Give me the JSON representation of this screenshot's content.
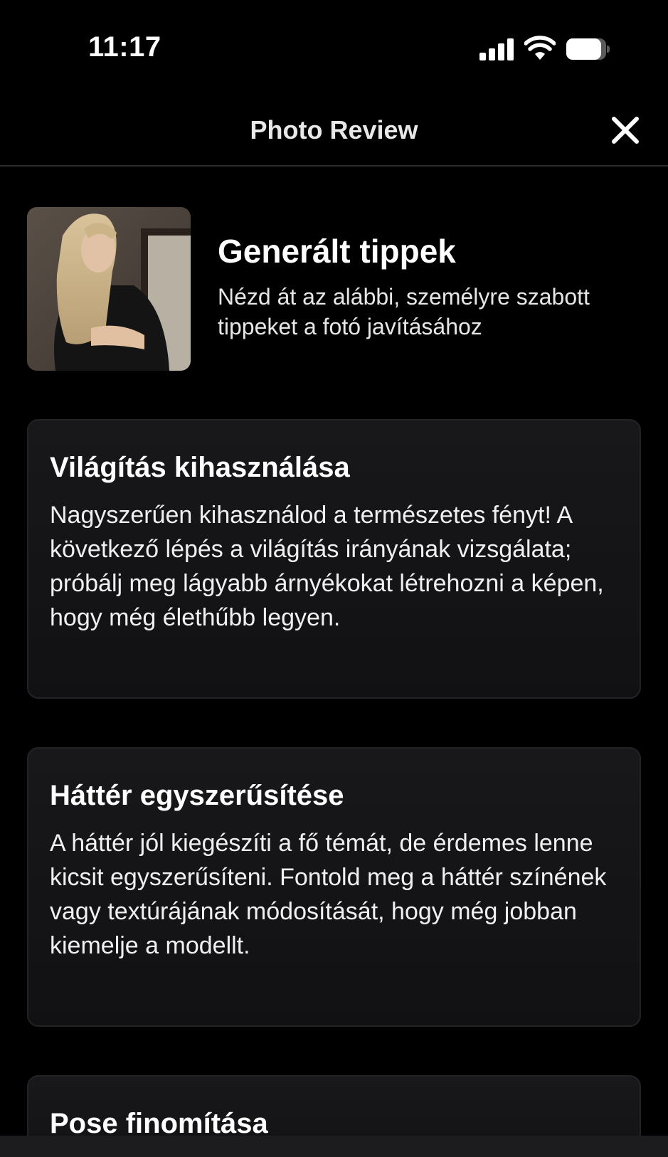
{
  "status_bar": {
    "time": "11:17",
    "battery_level": 0.88
  },
  "nav": {
    "title": "Photo Review",
    "close_icon": "close-icon"
  },
  "header": {
    "title": "Generált tippek",
    "subtitle": "Nézd át az alábbi, személyre szabott tippeket a fotó javításához"
  },
  "tips": [
    {
      "title": "Világítás kihasználása",
      "body": "Nagyszerűen kihasználod a természetes fényt! A következő lépés a világítás irányának vizsgálata; próbálj meg lágyabb árnyékokat létrehozni a képen, hogy még élethűbb legyen."
    },
    {
      "title": "Háttér egyszerűsítése",
      "body": "A háttér jól kiegészíti a fő témát, de érdemes lenne kicsit egyszerűsíteni. Fontold meg a háttér színének vagy textúrájának módosítását, hogy még jobban kiemelje a modellt."
    },
    {
      "title": "Pose finomítása",
      "body": ""
    }
  ],
  "colors": {
    "background": "#000000",
    "card": "#151517",
    "text": "#ffffff"
  }
}
